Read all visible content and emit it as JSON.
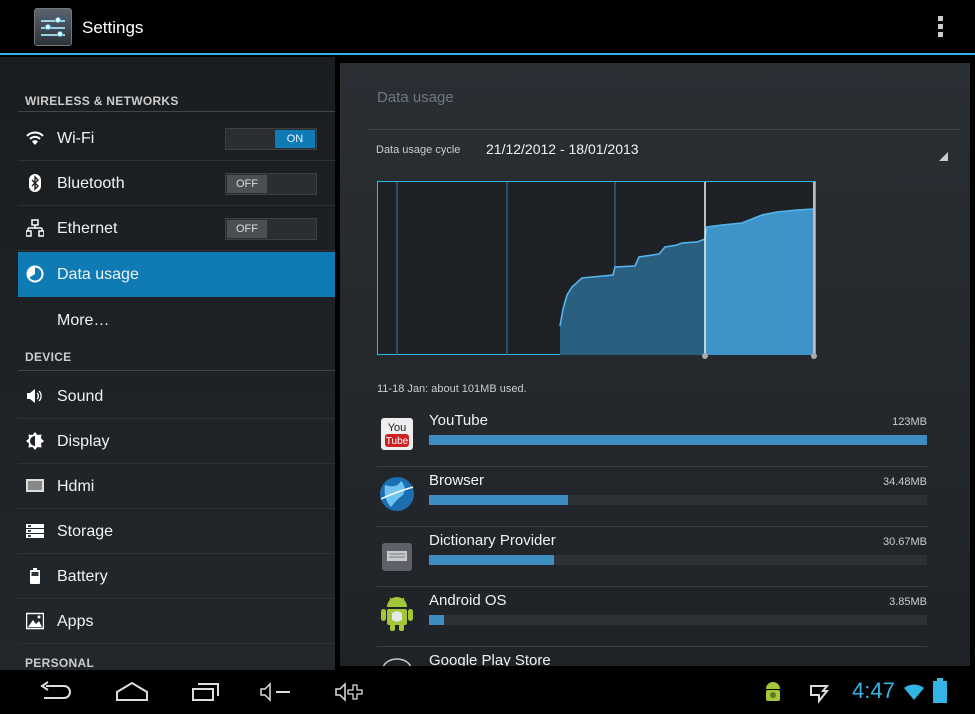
{
  "app": {
    "title": "Settings"
  },
  "sidebar": {
    "sections": [
      {
        "label": "WIRELESS & NETWORKS"
      },
      {
        "label": "DEVICE"
      },
      {
        "label": "PERSONAL"
      }
    ],
    "items": [
      {
        "label": "Wi-Fi",
        "icon": "wifi-icon",
        "toggle": "ON"
      },
      {
        "label": "Bluetooth",
        "icon": "bluetooth-icon",
        "toggle": "OFF"
      },
      {
        "label": "Ethernet",
        "icon": "ethernet-icon",
        "toggle": "OFF"
      },
      {
        "label": "Data usage",
        "icon": "data-usage-icon",
        "active": true
      },
      {
        "label": "More…",
        "icon": ""
      },
      {
        "label": "Sound",
        "icon": "sound-icon"
      },
      {
        "label": "Display",
        "icon": "display-icon"
      },
      {
        "label": "Hdmi",
        "icon": "hdmi-icon"
      },
      {
        "label": "Storage",
        "icon": "storage-icon"
      },
      {
        "label": "Battery",
        "icon": "battery-icon"
      },
      {
        "label": "Apps",
        "icon": "apps-icon"
      }
    ]
  },
  "main": {
    "title": "Data usage",
    "cycle_label": "Data usage cycle",
    "cycle_value": "21/12/2012 - 18/01/2013",
    "summary": "11-18 Jan: about 101MB used.",
    "apps": [
      {
        "name": "YouTube",
        "size": "123MB",
        "fraction": 1.0,
        "icon": "youtube-icon"
      },
      {
        "name": "Browser",
        "size": "34.48MB",
        "fraction": 0.28,
        "icon": "browser-icon"
      },
      {
        "name": "Dictionary Provider",
        "size": "30.67MB",
        "fraction": 0.25,
        "icon": "keyboard-icon"
      },
      {
        "name": "Android OS",
        "size": "3.85MB",
        "fraction": 0.03,
        "icon": "android-icon"
      },
      {
        "name": "Google Play Store",
        "size": "",
        "fraction": 0.0,
        "icon": "play-store-icon"
      }
    ]
  },
  "status": {
    "time": "4:47"
  },
  "colors": {
    "accent": "#33b5e5",
    "active_item": "#0e7bb5",
    "chart_fill": "#3d8cc2"
  }
}
